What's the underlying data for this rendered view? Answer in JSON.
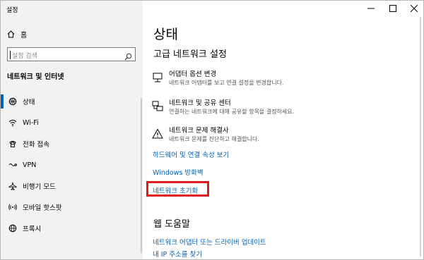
{
  "window": {
    "title": "설정"
  },
  "sidebar": {
    "home_label": "홈",
    "search_placeholder": "설정 검색",
    "section_title": "네트워크 및 인터넷",
    "items": [
      {
        "label": "상태",
        "icon": "globe-status-icon",
        "active": true
      },
      {
        "label": "Wi-Fi",
        "icon": "wifi-icon"
      },
      {
        "label": "전화 접속",
        "icon": "phone-icon"
      },
      {
        "label": "VPN",
        "icon": "vpn-icon"
      },
      {
        "label": "비행기 모드",
        "icon": "airplane-icon"
      },
      {
        "label": "모바일 핫스팟",
        "icon": "hotspot-icon"
      },
      {
        "label": "프록시",
        "icon": "globe-icon"
      }
    ]
  },
  "main": {
    "title": "상태",
    "subtitle": "고급 네트워크 설정",
    "options": [
      {
        "title": "어댑터 옵션 변경",
        "desc": "네트워크 어댑터를 보고 연결 설정을 변경합니다."
      },
      {
        "title": "네트워크 및 공유 센터",
        "desc": "연결하는 네트워크에 대해 공유할 항목을 결정하세요."
      },
      {
        "title": "네트워크 문제 해결사",
        "desc": "네트워크 문제를 진단하고 해결합니다."
      }
    ],
    "links": {
      "hardware": "하드웨어 및 연결 속성 보기",
      "firewall": "Windows 방화벽",
      "reset": "네트워크 초기화"
    },
    "help": {
      "title": "웹 도움말",
      "update_driver": "네트워크 어댑터 또는 드라이버 업데이트",
      "find_ip": "내 IP 주소를 찾기"
    }
  },
  "colors": {
    "accent": "#0063b1",
    "link": "#0060b5",
    "highlight": "#e11b1b",
    "sidebar_bg": "#f2f2f2"
  }
}
